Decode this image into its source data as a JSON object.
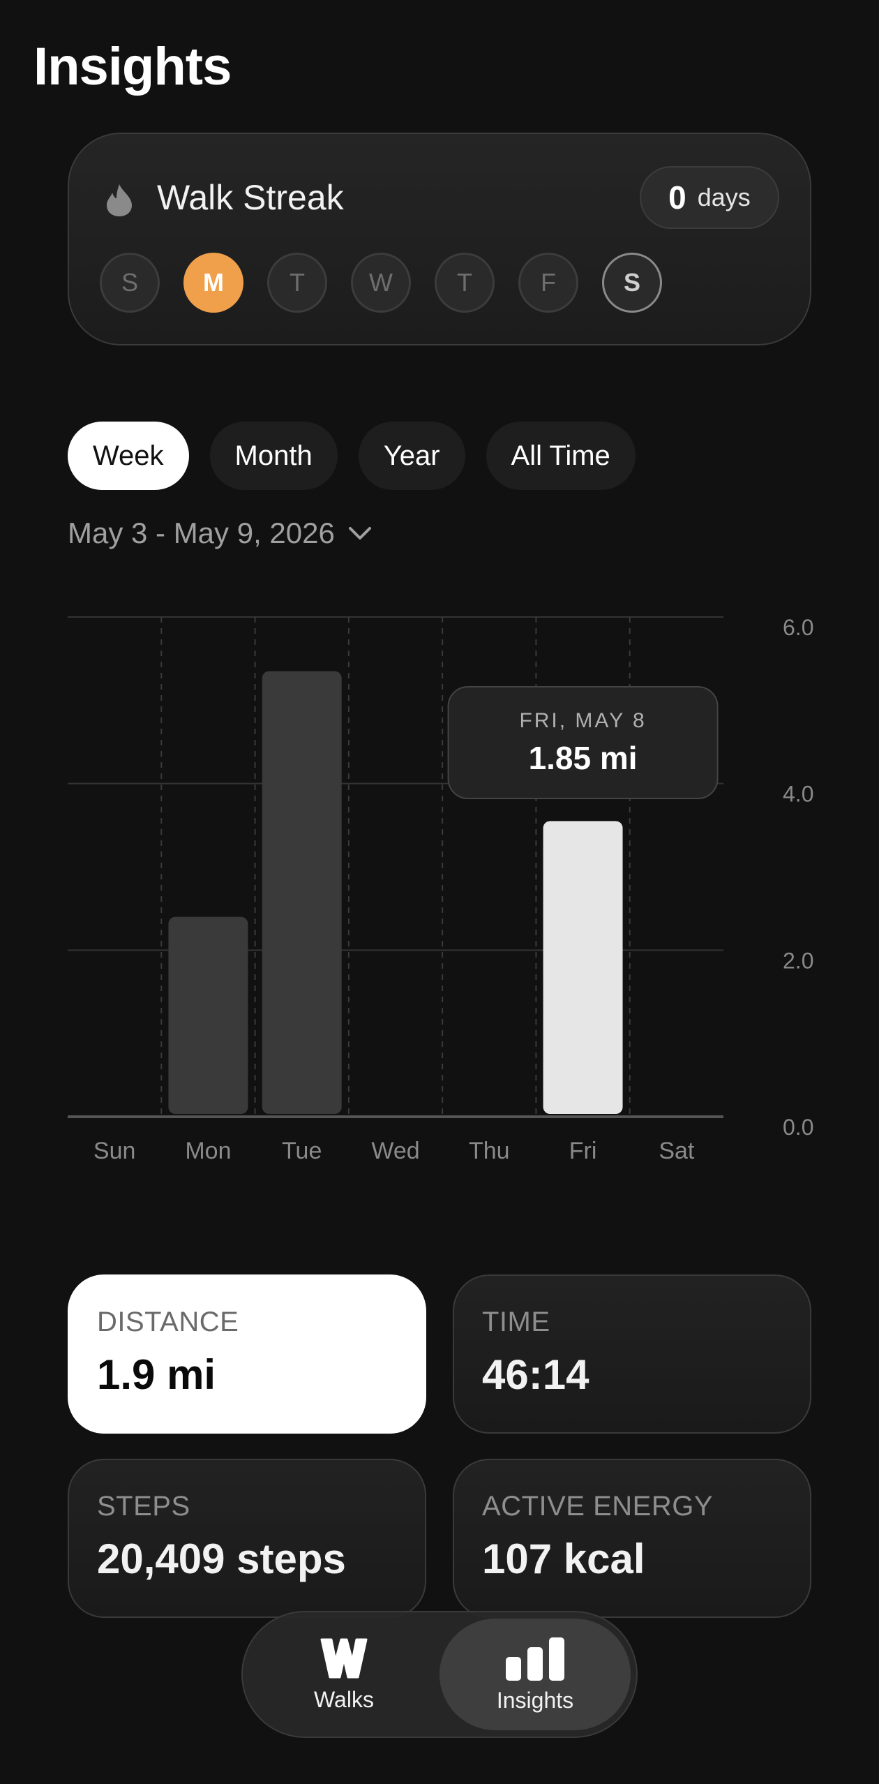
{
  "header": {
    "title": "Insights"
  },
  "streak": {
    "title": "Walk Streak",
    "count": "0",
    "count_unit": "days",
    "days": [
      {
        "letter": "S",
        "state": "inactive"
      },
      {
        "letter": "M",
        "state": "active"
      },
      {
        "letter": "T",
        "state": "inactive"
      },
      {
        "letter": "W",
        "state": "inactive"
      },
      {
        "letter": "T",
        "state": "inactive"
      },
      {
        "letter": "F",
        "state": "inactive"
      },
      {
        "letter": "S",
        "state": "today"
      }
    ],
    "accent_color": "#f0a04b"
  },
  "periods": [
    {
      "label": "Week",
      "selected": true
    },
    {
      "label": "Month",
      "selected": false
    },
    {
      "label": "Year",
      "selected": false
    },
    {
      "label": "All Time",
      "selected": false
    }
  ],
  "date_range": "May 3 - May 9, 2026",
  "chart_data": {
    "type": "bar",
    "categories": [
      "Sun",
      "Mon",
      "Tue",
      "Wed",
      "Thu",
      "Fri",
      "Sat"
    ],
    "values": [
      0,
      2.4,
      5.35,
      0,
      0,
      3.55,
      0
    ],
    "highlight_index": 5,
    "y_ticks": [
      "6.0",
      "4.0",
      "2.0",
      "0.0"
    ],
    "ylim": [
      0,
      6
    ],
    "grid": true,
    "tooltip": {
      "date": "FRI, MAY 8",
      "value": "1.85 mi"
    }
  },
  "stats": [
    {
      "label": "DISTANCE",
      "value": "1.9 mi",
      "selected": true
    },
    {
      "label": "TIME",
      "value": "46:14",
      "selected": false
    },
    {
      "label": "STEPS",
      "value": "20,409 steps",
      "selected": false
    },
    {
      "label": "ACTIVE ENERGY",
      "value": "107 kcal",
      "selected": false
    }
  ],
  "tabs": [
    {
      "label": "Walks",
      "icon": "walks-logo-icon",
      "selected": false
    },
    {
      "label": "Insights",
      "icon": "bar-chart-icon",
      "selected": true
    }
  ]
}
